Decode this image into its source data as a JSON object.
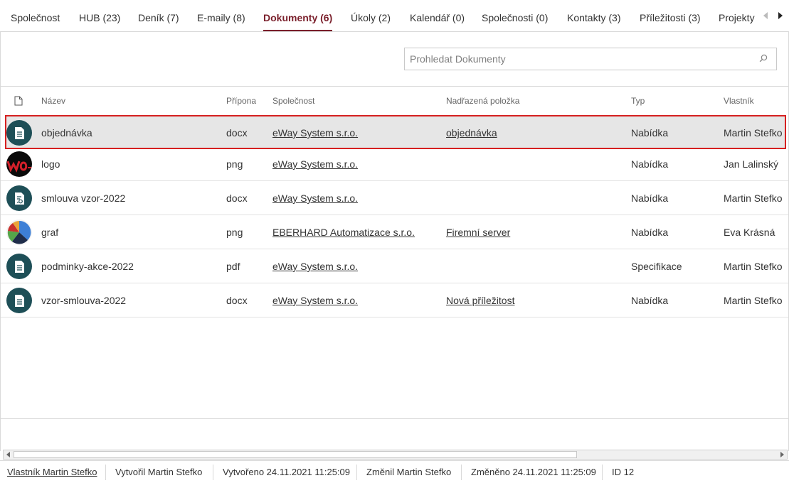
{
  "tabs": [
    {
      "label": "Společnost"
    },
    {
      "label": "HUB (23)"
    },
    {
      "label": "Deník (7)"
    },
    {
      "label": "E-maily (8)"
    },
    {
      "label": "Dokumenty (6)",
      "active": true
    },
    {
      "label": "Úkoly (2)"
    },
    {
      "label": "Kalendář (0)"
    },
    {
      "label": "Společnosti (0)"
    },
    {
      "label": "Kontakty (3)"
    },
    {
      "label": "Příležitosti (3)"
    },
    {
      "label": "Projekty"
    }
  ],
  "search": {
    "placeholder": "Prohledat Dokumenty"
  },
  "table": {
    "headers": {
      "name": "Název",
      "ext": "Přípona",
      "company": "Společnost",
      "parent": "Nadřazená položka",
      "type": "Typ",
      "owner": "Vlastník"
    },
    "rows": [
      {
        "icon": "document-icon",
        "name": "objednávka",
        "ext": "docx",
        "company": "eWay System s.r.o.",
        "parent": "objednávka",
        "type": "Nabídka",
        "owner": "Martin Stefko",
        "selected": true
      },
      {
        "icon": "logo-thumbnail",
        "name": "logo",
        "ext": "png",
        "company": "eWay System s.r.o.",
        "parent": "",
        "type": "Nabídka",
        "owner": "Jan Lalinský"
      },
      {
        "icon": "contract-document-icon",
        "name": "smlouva vzor-2022",
        "ext": "docx",
        "company": "eWay System s.r.o.",
        "parent": "",
        "type": "Nabídka",
        "owner": "Martin Stefko"
      },
      {
        "icon": "pie-chart-thumbnail",
        "name": "graf",
        "ext": "png",
        "company": "EBERHARD Automatizace s.r.o.",
        "parent": "Firemní server",
        "type": "Nabídka",
        "owner": "Eva Krásná"
      },
      {
        "icon": "document-icon",
        "name": "podminky-akce-2022",
        "ext": "pdf",
        "company": "eWay System s.r.o.",
        "parent": "",
        "type": "Specifikace",
        "owner": "Martin Stefko"
      },
      {
        "icon": "document-icon",
        "name": "vzor-smlouva-2022",
        "ext": "docx",
        "company": "eWay System s.r.o.",
        "parent": "Nová příležitost",
        "type": "Nabídka",
        "owner": "Martin Stefko"
      }
    ]
  },
  "footer": {
    "owner": "Vlastník Martin Stefko",
    "created_by": "Vytvořil Martin Stefko",
    "created": "Vytvořeno 24.11.2021 11:25:09",
    "modified_by": "Změnil Martin Stefko",
    "modified": "Změněno 24.11.2021 11:25:09",
    "id": "ID 12"
  },
  "colors": {
    "accent": "#7a1f2b",
    "doc_icon_bg": "#1e4f57",
    "selection_outline": "#d62020",
    "selected_row_bg": "#e6e6e6"
  }
}
